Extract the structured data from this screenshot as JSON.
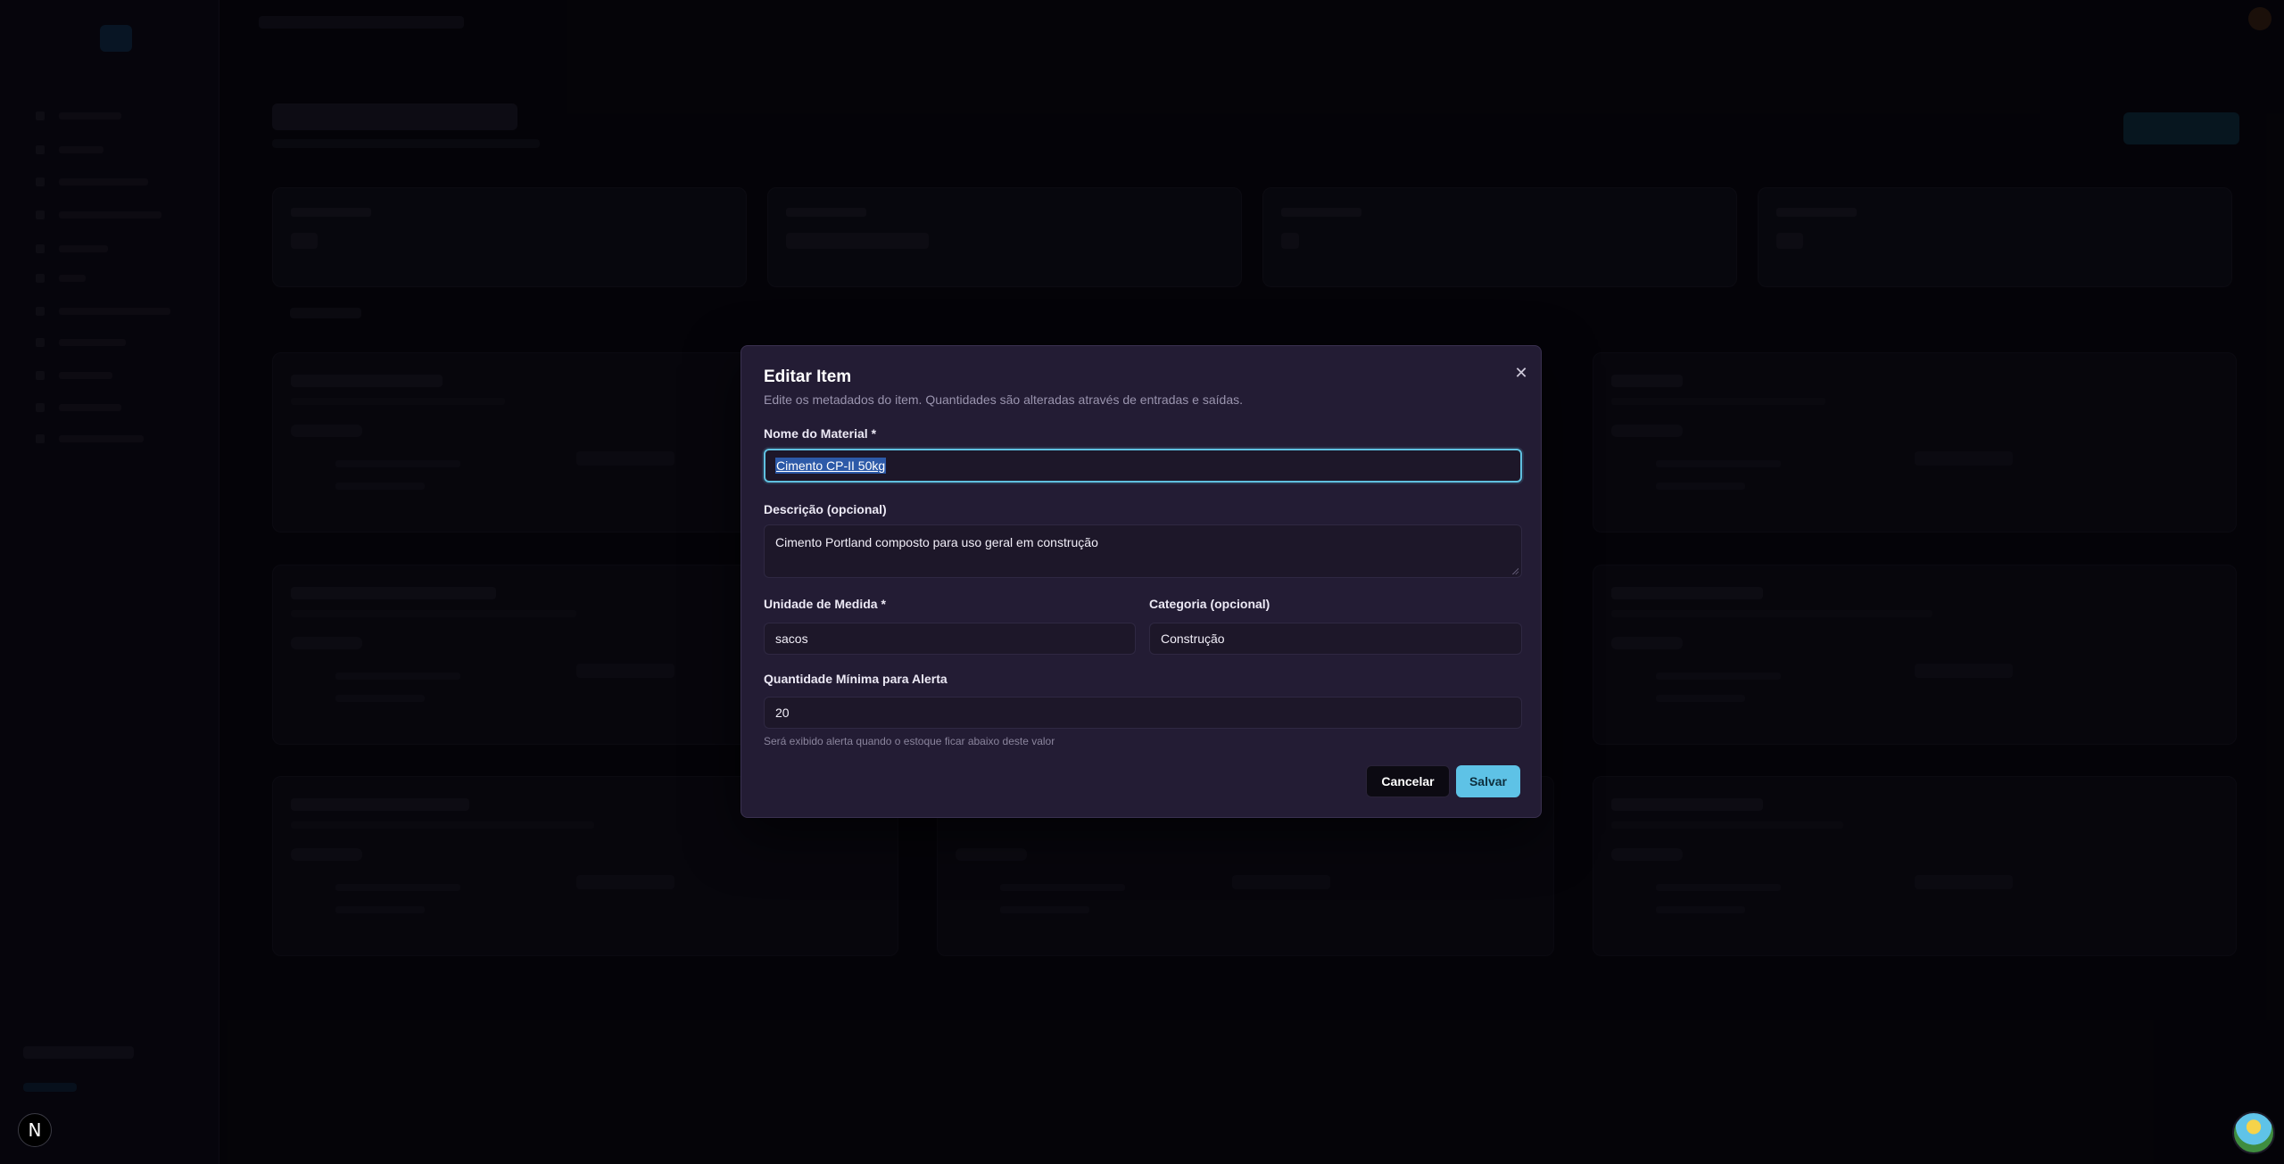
{
  "modal": {
    "title": "Editar Item",
    "description": "Edite os metadados do item. Quantidades são alteradas através de entradas e saídas.",
    "close_icon": "close-icon",
    "fields": {
      "material_name": {
        "label": "Nome do Material *",
        "value": "Cimento CP-II 50kg"
      },
      "description": {
        "label": "Descrição (opcional)",
        "value": "Cimento Portland composto para uso geral em construção"
      },
      "unit": {
        "label": "Unidade de Medida *",
        "value": "sacos"
      },
      "category": {
        "label": "Categoria (opcional)",
        "value": "Construção"
      },
      "min_quantity": {
        "label": "Quantidade Mínima para Alerta",
        "value": "20",
        "hint": "Será exibido alerta quando o estoque ficar abaixo deste valor"
      }
    },
    "buttons": {
      "cancel": "Cancelar",
      "save": "Salvar"
    }
  },
  "colors": {
    "accent": "#5ec2e6",
    "modal_bg": "#231c34",
    "page_bg": "#07060d"
  },
  "badges": {
    "framework_badge_text": "N"
  }
}
